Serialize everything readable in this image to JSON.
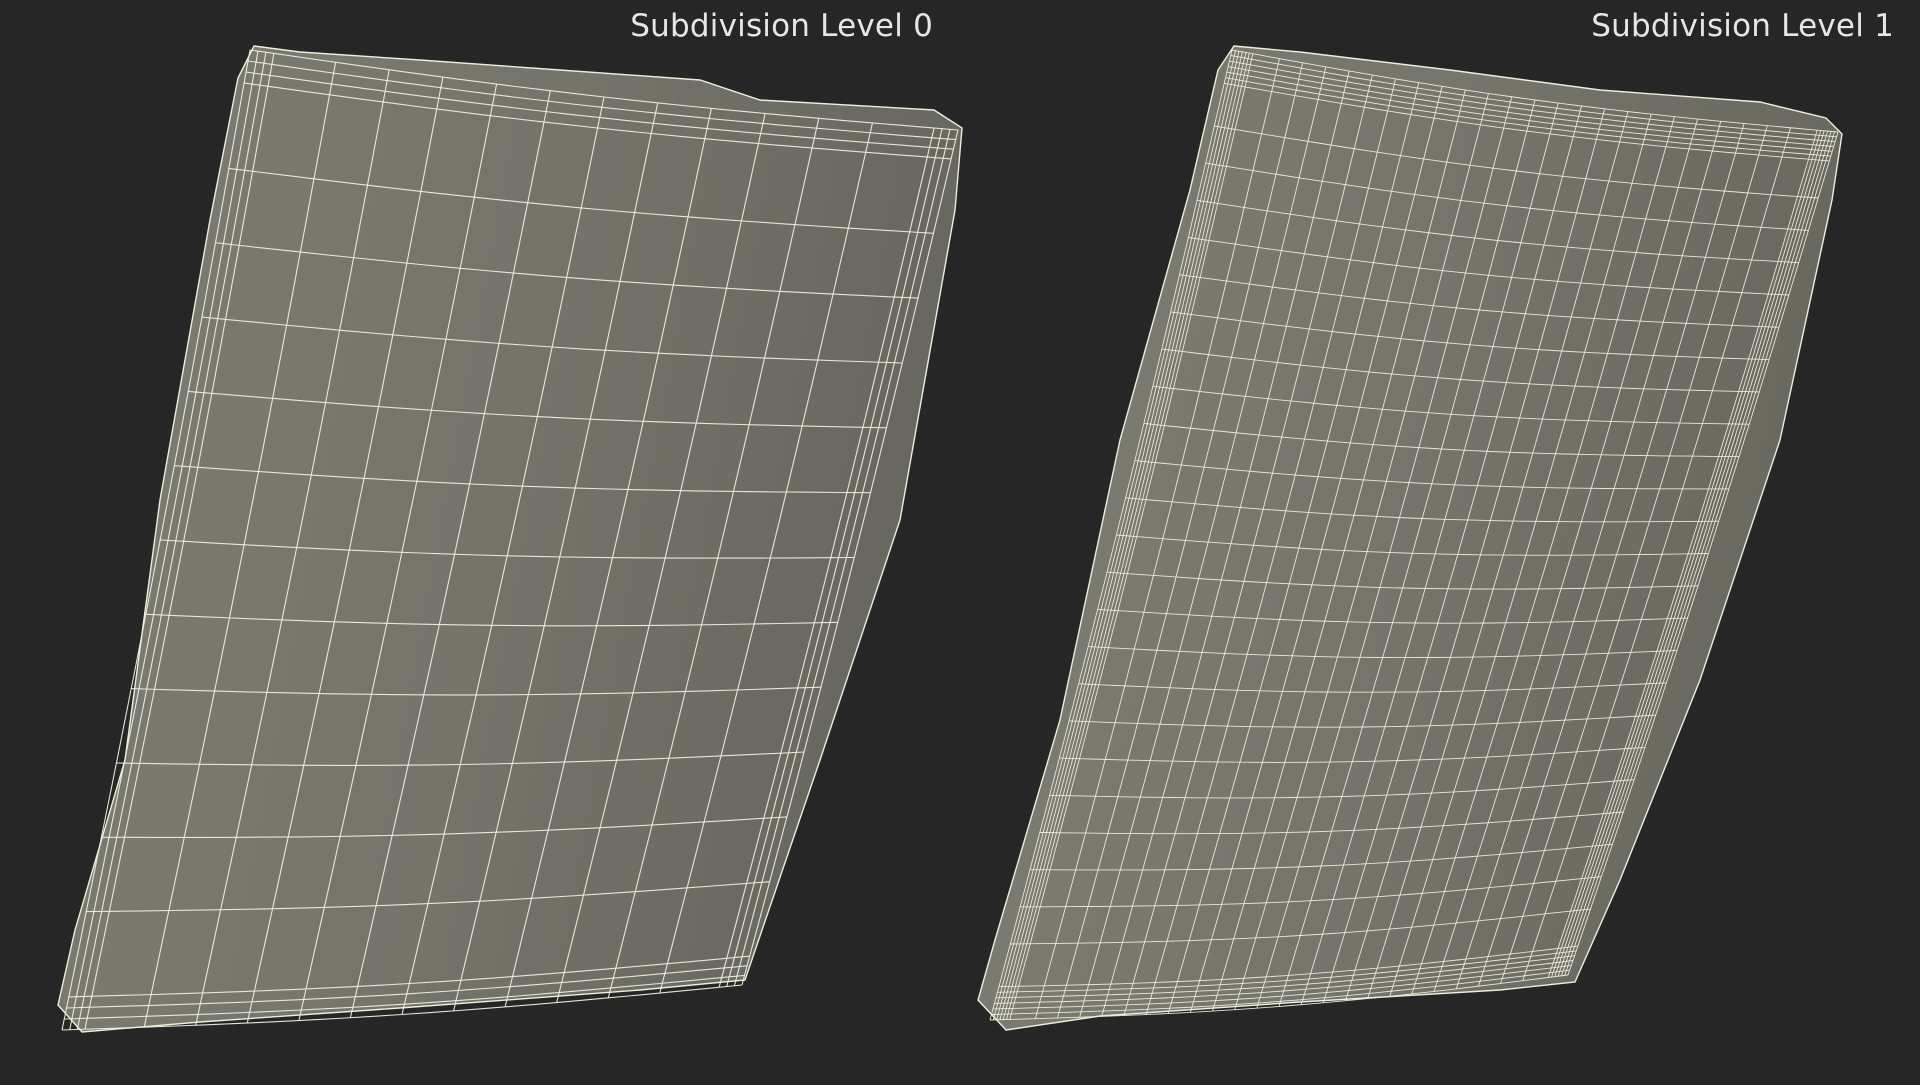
{
  "panels": [
    {
      "label": "Subdivision Level 0",
      "subdivision_level": 0
    },
    {
      "label": "Subdivision Level 1",
      "subdivision_level": 1
    }
  ],
  "colors": {
    "background": "#262626",
    "surface": "#74746b",
    "wire": "#eeeedd",
    "caption": "#e6e6e6"
  }
}
